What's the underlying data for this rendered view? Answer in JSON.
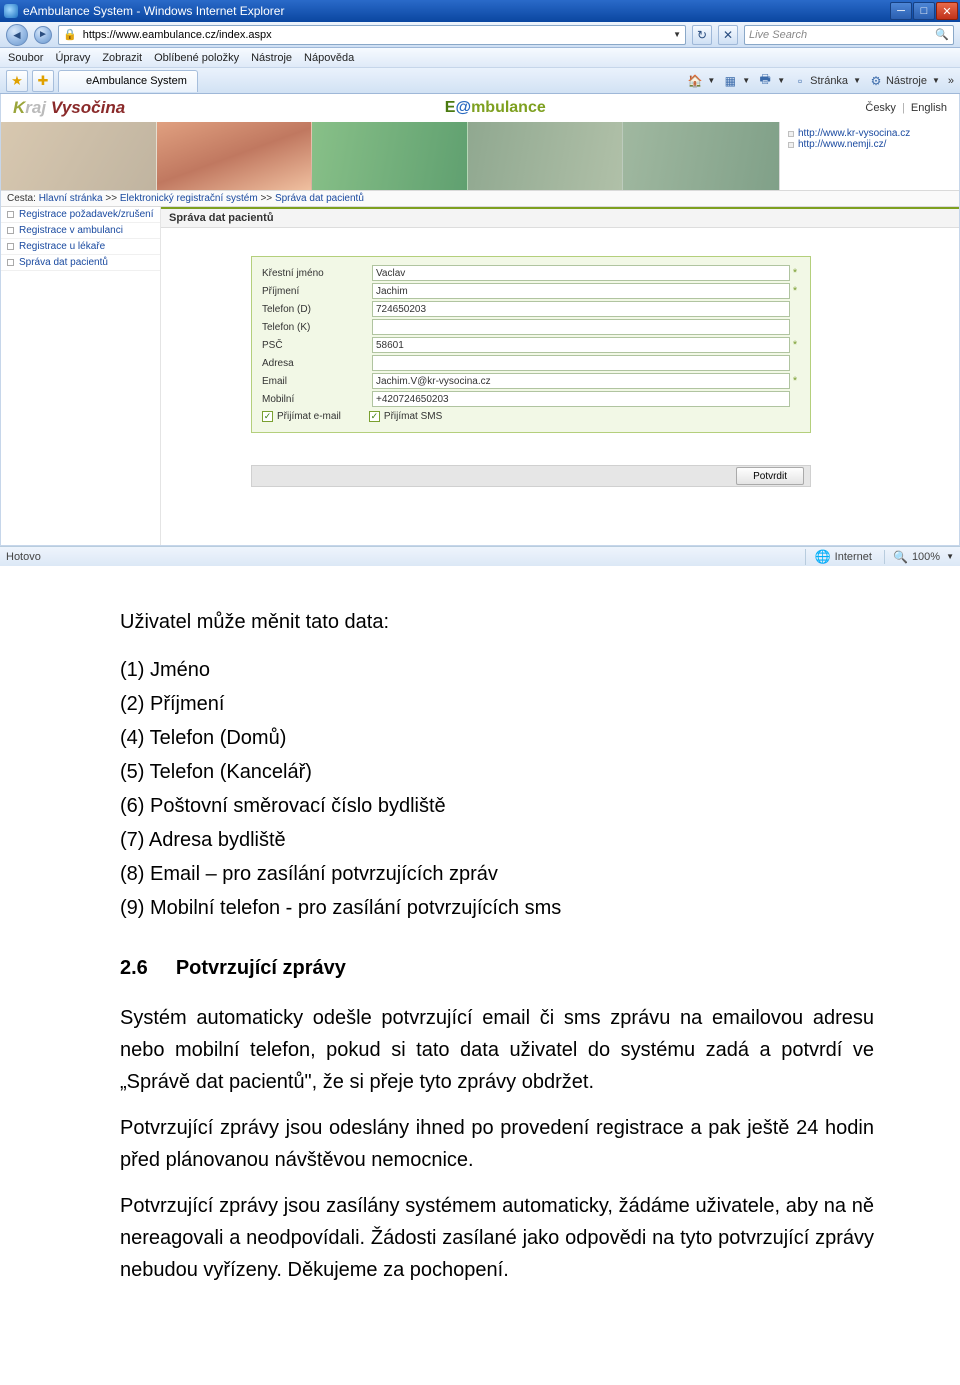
{
  "browser": {
    "title": "eAmbulance System - Windows Internet Explorer",
    "url": "https://www.eambulance.cz/index.aspx",
    "search_placeholder": "Live Search",
    "menu": [
      "Soubor",
      "Úpravy",
      "Zobrazit",
      "Oblíbené položky",
      "Nástroje",
      "Nápověda"
    ],
    "tab_label": "eAmbulance System",
    "toolbar": {
      "page_label": "Stránka",
      "tools_label": "Nástroje"
    },
    "status_left": "Hotovo",
    "status_zone": "Internet",
    "status_zoom": "100%"
  },
  "app": {
    "logo_prefix": "Kraj",
    "logo_suffix": "Vysočina",
    "brand": "E@mbulance",
    "lang": {
      "cs": "Česky",
      "en": "English"
    },
    "side_links": [
      "http://www.kr-vysocina.cz",
      "http://www.nemji.cz/"
    ],
    "breadcrumb": {
      "label": "Cesta:",
      "parts": [
        "Hlavní stránka",
        "Elektronický registrační systém",
        "Správa dat pacientů"
      ]
    },
    "sidebar": [
      "Registrace požadavek/zrušení",
      "Registrace v ambulanci",
      "Registrace u lékaře",
      "Správa dat pacientů"
    ],
    "panel_title": "Správa dat pacientů",
    "form": {
      "fields": [
        {
          "label": "Křestní jméno",
          "value": "Vaclav",
          "required": true
        },
        {
          "label": "Příjmení",
          "value": "Jachim",
          "required": true
        },
        {
          "label": "Telefon (D)",
          "value": "724650203",
          "required": false
        },
        {
          "label": "Telefon (K)",
          "value": "",
          "required": false
        },
        {
          "label": "PSČ",
          "value": "58601",
          "required": true
        },
        {
          "label": "Adresa",
          "value": "",
          "required": false
        },
        {
          "label": "Email",
          "value": "Jachim.V@kr-vysocina.cz",
          "required": true
        },
        {
          "label": "Mobilní",
          "value": "+420724650203",
          "required": false
        }
      ],
      "chk_email": "Přijímat e-mail",
      "chk_sms": "Přijímat SMS",
      "submit": "Potvrdit"
    }
  },
  "document": {
    "intro": "Uživatel může měnit tato data:",
    "items": [
      "(1) Jméno",
      "(2) Příjmení",
      "(4) Telefon (Domů)",
      "(5) Telefon (Kancelář)",
      "(6) Poštovní směrovací číslo bydliště",
      "(7) Adresa bydliště",
      "(8) Email – pro zasílání potvrzujících zpráv",
      "(9) Mobilní telefon - pro zasílání potvrzujících sms"
    ],
    "section_num": "2.6",
    "section_title": "Potvrzující zprávy",
    "p1": "Systém automaticky odešle potvrzující email či sms zprávu na emailovou adresu nebo mobilní telefon, pokud si tato data uživatel do systému zadá a potvrdí ve „Správě dat pacientů\", že si přeje tyto zprávy obdržet.",
    "p2": "Potvrzující zprávy jsou odeslány ihned po provedení registrace a pak ještě 24 hodin před plánovanou návštěvou nemocnice.",
    "p3": "Potvrzující zprávy jsou zasílány systémem automaticky, žádáme uživatele, aby na ně nereagovali a neodpovídali. Žádosti zasílané jako odpovědi na tyto potvrzující zprávy nebudou vyřízeny. Děkujeme za pochopení."
  }
}
